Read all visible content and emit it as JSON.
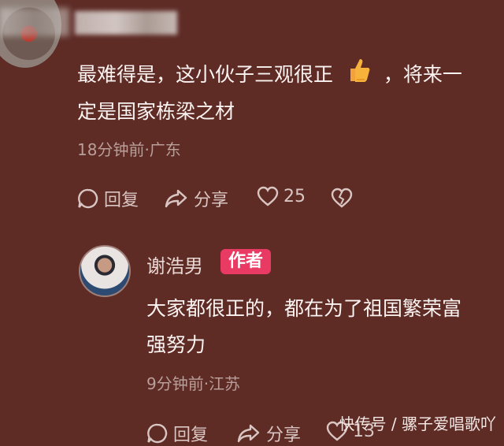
{
  "top_comment": {
    "text_line1": "最难得是，这小伙子三观很正",
    "text_line1_tail": "，将来一",
    "text_line2": "定是国家栋梁之材",
    "meta": "18分钟前·广东",
    "actions": {
      "reply": "回复",
      "share": "分享",
      "likes": "25"
    }
  },
  "author_reply": {
    "name": "谢浩男",
    "badge": "作者",
    "text_line1": "大家都很正的，都在为了祖国繁荣富",
    "text_line2": "强努力",
    "meta": "9分钟前·江苏",
    "actions": {
      "reply": "回复",
      "share": "分享",
      "likes": "13"
    }
  },
  "watermark": "快传号 / 骡子爱唱歌吖",
  "colors": {
    "background": "#5e2b25",
    "author_badge": "#e83a62",
    "meta_text": "#b99f9a"
  }
}
